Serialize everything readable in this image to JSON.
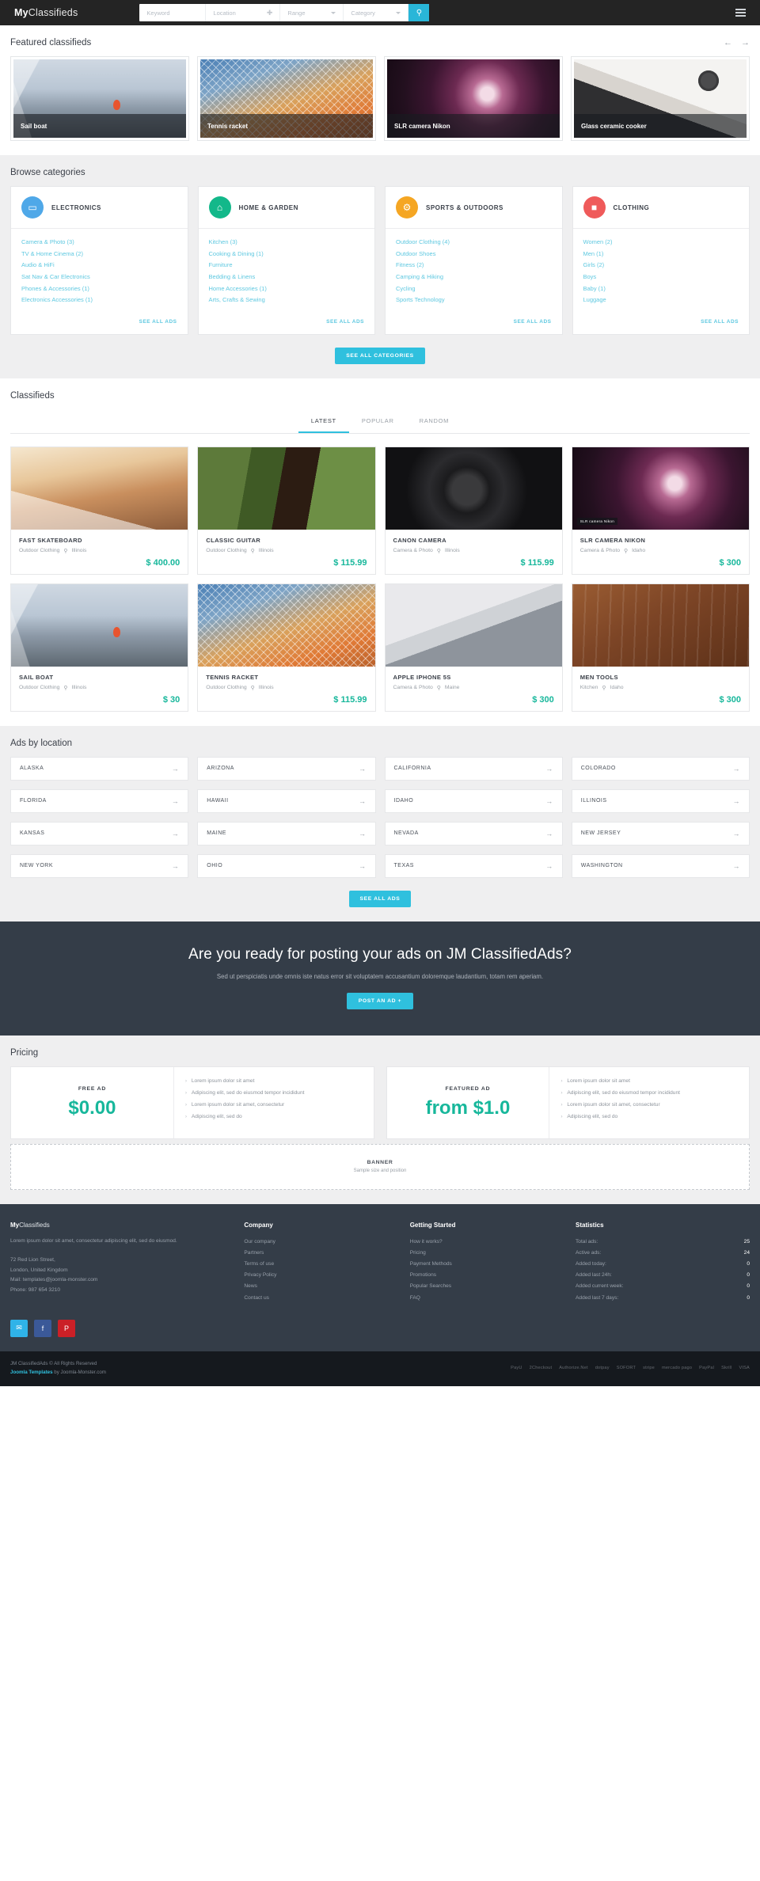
{
  "header": {
    "logo_bold": "My",
    "logo_light": "Classifieds",
    "search": {
      "keyword_placeholder": "Keyword",
      "location_placeholder": "Location",
      "range_placeholder": "Range",
      "category_placeholder": "Category",
      "gps_icon": "crosshairs-icon",
      "search_icon": "search-icon",
      "menu_icon": "hamburger-menu-icon"
    },
    "accent": "#29b6d8"
  },
  "featured": {
    "title": "Featured classifieds",
    "prev_icon": "arrow-left-icon",
    "next_icon": "arrow-right-icon",
    "items": [
      {
        "caption": "Sail boat",
        "img": "img-boat"
      },
      {
        "caption": "Tennis racket",
        "img": "img-racket"
      },
      {
        "caption": "SLR camera Nikon",
        "img": "img-lens"
      },
      {
        "caption": "Glass ceramic cooker",
        "img": "img-cooker"
      }
    ]
  },
  "categories": {
    "title": "Browse categories",
    "see_all_label": "SEE ALL ADS",
    "see_all_categories_label": "SEE ALL CATEGORIES",
    "cards": [
      {
        "name": "ELECTRONICS",
        "icon": "laptop-icon",
        "glyph": "▭",
        "color": "#4fa8e8",
        "links": [
          "Camera & Photo (3)",
          "TV & Home Cinema (2)",
          "Audio & HiFi",
          "Sat Nav & Car Electronics",
          "Phones & Accessories (1)",
          "Electronics Accessories (1)"
        ]
      },
      {
        "name": "HOME & GARDEN",
        "icon": "house-icon",
        "glyph": "⌂",
        "color": "#13b88a",
        "links": [
          "Kitchen (3)",
          "Cooking & Dining (1)",
          "Furniture",
          "Bedding & Linens",
          "Home Accessories (1)",
          "Arts, Crafts & Sewing"
        ]
      },
      {
        "name": "SPORTS & OUTDOORS",
        "icon": "gear-icon",
        "glyph": "⚙",
        "color": "#f5a623",
        "links": [
          "Outdoor Clothing (4)",
          "Outdoor Shoes",
          "Fitness (2)",
          "Camping & Hiking",
          "Cycling",
          "Sports Technology"
        ]
      },
      {
        "name": "CLOTHING",
        "icon": "bag-icon",
        "glyph": "■",
        "color": "#ef5a5a",
        "links": [
          "Women (2)",
          "Men (1)",
          "Girls (2)",
          "Boys",
          "Baby (1)",
          "Luggage"
        ]
      }
    ]
  },
  "classifieds": {
    "title": "Classifieds",
    "tabs": [
      {
        "label": "LATEST",
        "active": true
      },
      {
        "label": "POPULAR",
        "active": false
      },
      {
        "label": "RANDOM",
        "active": false
      }
    ],
    "items": [
      {
        "title": "FAST SKATEBOARD",
        "category": "Outdoor Clothing",
        "location": "Illinois",
        "price": "$ 400.00",
        "img": "img-skate",
        "badge": ""
      },
      {
        "title": "CLASSIC GUITAR",
        "category": "Outdoor Clothing",
        "location": "Illinois",
        "price": "$ 115.99",
        "img": "img-guitar",
        "badge": ""
      },
      {
        "title": "CANON CAMERA",
        "category": "Camera & Photo",
        "location": "Illinois",
        "price": "$ 115.99",
        "img": "img-canon",
        "badge": ""
      },
      {
        "title": "SLR CAMERA NIKON",
        "category": "Camera & Photo",
        "location": "Idaho",
        "price": "$ 300",
        "img": "img-lens",
        "badge": "SLR camera Nikon"
      },
      {
        "title": "SAIL BOAT",
        "category": "Outdoor Clothing",
        "location": "Illinois",
        "price": "$ 30",
        "img": "img-boat",
        "badge": ""
      },
      {
        "title": "TENNIS RACKET",
        "category": "Outdoor Clothing",
        "location": "Illinois",
        "price": "$ 115.99",
        "img": "img-racket",
        "badge": ""
      },
      {
        "title": "APPLE IPHONE 5S",
        "category": "Camera & Photo",
        "location": "Maine",
        "price": "$ 300",
        "img": "img-phone",
        "badge": ""
      },
      {
        "title": "MEN TOOLS",
        "category": "Kitchen",
        "location": "Idaho",
        "price": "$ 300",
        "img": "img-tools",
        "badge": ""
      }
    ]
  },
  "locations": {
    "title": "Ads by location",
    "see_all_label": "SEE ALL ADS",
    "arrow_icon": "arrow-right-icon",
    "items": [
      "ALASKA",
      "ARIZONA",
      "CALIFORNIA",
      "COLORADO",
      "FLORIDA",
      "HAWAII",
      "IDAHO",
      "ILLINOIS",
      "KANSAS",
      "MAINE",
      "NEVADA",
      "NEW JERSEY",
      "NEW YORK",
      "OHIO",
      "TEXAS",
      "WASHINGTON"
    ]
  },
  "cta": {
    "heading": "Are you ready for posting your ads on JM ClassifiedAds?",
    "sub": "Sed ut perspiciatis unde omnis iste natus error sit voluptatem accusantium doloremque laudantium, totam rem aperiam.",
    "button": "POST AN AD +"
  },
  "pricing": {
    "title": "Pricing",
    "plans": [
      {
        "label": "FREE AD",
        "value": "$0.00",
        "features": [
          "Lorem ipsum dolor sit amet",
          "Adipiscing elit, sed do eiusmod tempor incididunt",
          "Lorem ipsum dolor sit amet, consectetur",
          "Adipiscing elit, sed do"
        ]
      },
      {
        "label": "FEATURED AD",
        "value": "from $1.0",
        "features": [
          "Lorem ipsum dolor sit amet",
          "Adipiscing elit, sed do eiusmod tempor incididunt",
          "Lorem ipsum dolor sit amet, consectetur",
          "Adipiscing elit, sed do"
        ]
      }
    ]
  },
  "banner": {
    "title": "BANNER",
    "sub": "Sample size and position"
  },
  "footer": {
    "brand_bold": "My",
    "brand_light": "Classifieds",
    "about": "Lorem ipsum dolor sit amet, consectetur adipiscing elit, sed do eiusmod.",
    "address_lines": [
      "72 Red Lion Street,",
      "London, United Kingdom",
      "Mail: templates@joomla-monster.com",
      "Phone: 987 654 3210"
    ],
    "columns": [
      {
        "heading": "Company",
        "links": [
          "Our company",
          "Partners",
          "Terms of use",
          "Privacy Policy",
          "News",
          "Contact us"
        ]
      },
      {
        "heading": "Getting Started",
        "links": [
          "How it works?",
          "Pricing",
          "Payment Methods",
          "Promotions",
          "Popular Searches",
          "FAQ"
        ]
      }
    ],
    "stats_heading": "Statistics",
    "stats": [
      {
        "label": "Total ads:",
        "value": "25"
      },
      {
        "label": "Active ads:",
        "value": "24"
      },
      {
        "label": "Added today:",
        "value": "0"
      },
      {
        "label": "Added last 24h:",
        "value": "0"
      },
      {
        "label": "Added current week:",
        "value": "0"
      },
      {
        "label": "Added last 7 days:",
        "value": "0"
      }
    ],
    "social": [
      {
        "name": "twitter-icon",
        "glyph": "✉",
        "color": "#2fb3e8"
      },
      {
        "name": "facebook-icon",
        "glyph": "f",
        "color": "#3b5998"
      },
      {
        "name": "pinterest-icon",
        "glyph": "P",
        "color": "#cb2027"
      }
    ],
    "copyright_line1": "JM ClassifiedAds © All Rights Reserved",
    "copyright_link": "Joomla Templates",
    "copyright_line2": " by Joomla-Monster.com",
    "payments": [
      "PayU",
      "2Checkout",
      "Authorize.Net",
      "dotpay",
      "SOFORT",
      "stripe",
      "mercado pago",
      "PayPal",
      "Skrill",
      "VISA"
    ]
  }
}
